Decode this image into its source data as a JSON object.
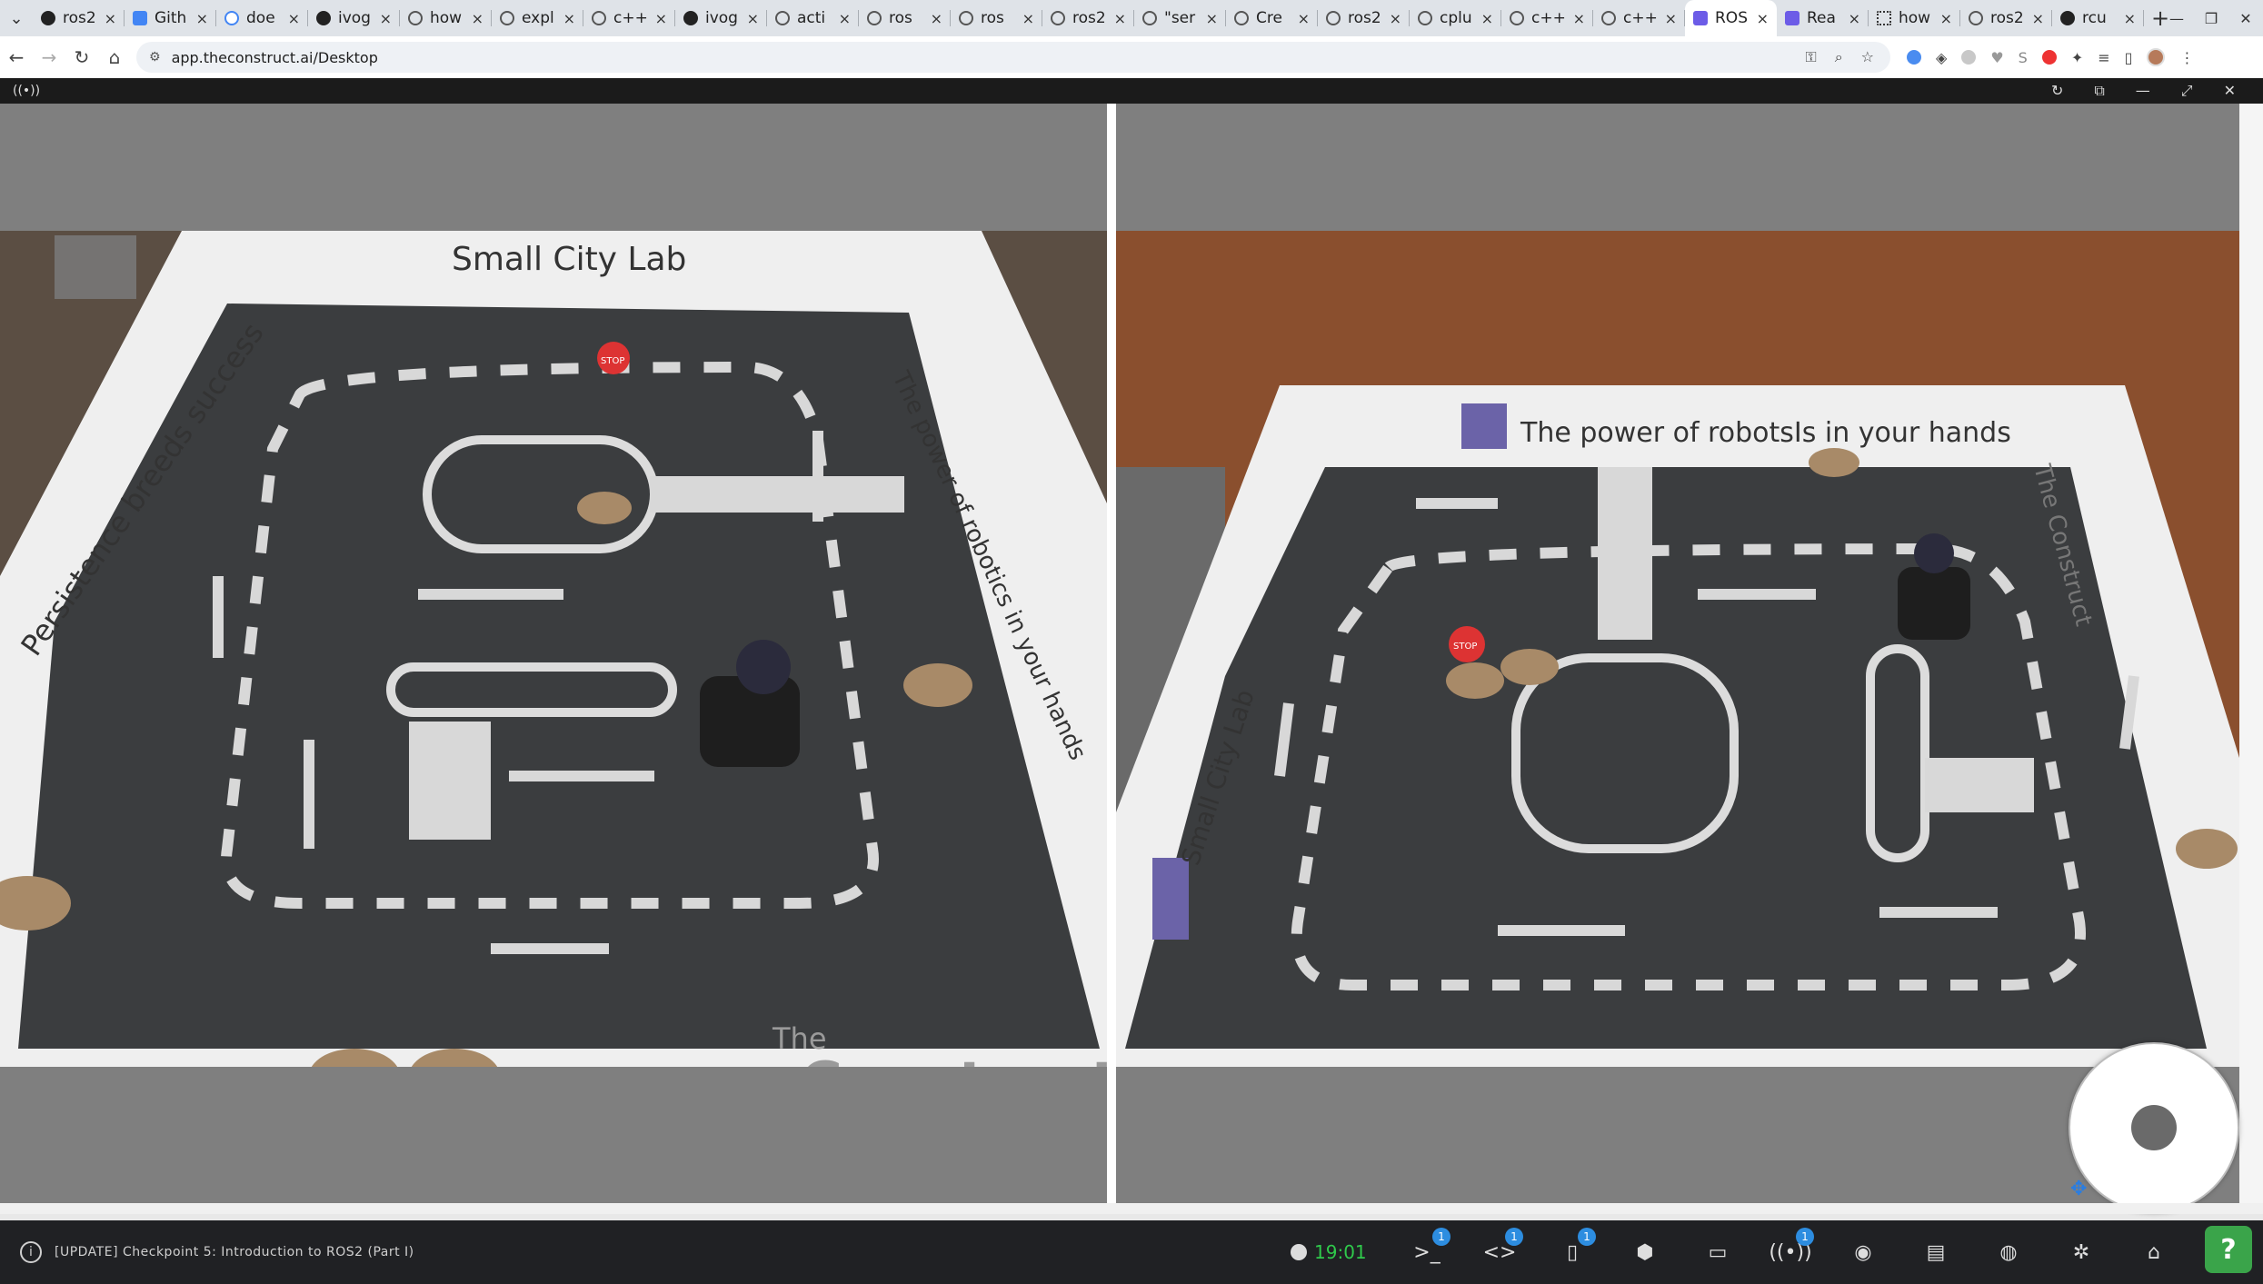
{
  "browser": {
    "tabs": [
      {
        "label": "ros2",
        "icon": "github-icon"
      },
      {
        "label": "Gith",
        "icon": "docs-icon"
      },
      {
        "label": "doe",
        "icon": "google-icon"
      },
      {
        "label": "ivog",
        "icon": "github-icon"
      },
      {
        "label": "how",
        "icon": "page-icon"
      },
      {
        "label": "expl",
        "icon": "chatgpt-icon"
      },
      {
        "label": "c++",
        "icon": "page-icon"
      },
      {
        "label": "ivog",
        "icon": "github-icon"
      },
      {
        "label": "acti",
        "icon": "page-icon"
      },
      {
        "label": "ros",
        "icon": "page-icon"
      },
      {
        "label": "ros",
        "icon": "page-icon"
      },
      {
        "label": "ros2",
        "icon": "page-icon"
      },
      {
        "label": "\"ser",
        "icon": "page-icon"
      },
      {
        "label": "Cre",
        "icon": "page-icon"
      },
      {
        "label": "ros2",
        "icon": "page-icon"
      },
      {
        "label": "cplu",
        "icon": "chatgpt-icon"
      },
      {
        "label": "c++",
        "icon": "page-icon"
      },
      {
        "label": "c++",
        "icon": "page-icon"
      },
      {
        "label": "ROS",
        "icon": "construct-icon",
        "active": true
      },
      {
        "label": "Rea",
        "icon": "construct-icon"
      },
      {
        "label": "how",
        "icon": "grid-icon"
      },
      {
        "label": "ros2",
        "icon": "page-icon"
      },
      {
        "label": "rcu",
        "icon": "github-icon"
      }
    ],
    "url": "app.theconstruct.ai/Desktop",
    "new_tab_symbol": "+",
    "close_symbol": "×"
  },
  "cameras": {
    "left": {
      "sign_top": "Small City Lab",
      "sign_left": "Persistence breeds success",
      "sign_right": "The power of robotics in your hands",
      "floor_logo_small": "The",
      "floor_logo_big": "Construct",
      "stop_text": "STOP"
    },
    "right": {
      "sign_top": "The power of robotsIs in your hands",
      "sign_left": "Small City Lab",
      "sign_right": "The Construct",
      "stop_text": "STOP"
    }
  },
  "status": {
    "update_text": "[UPDATE] Checkpoint 5: Introduction to ROS2 (Part I)",
    "timer": "19:01",
    "info_symbol": "i",
    "help_symbol": "?"
  },
  "dock": [
    {
      "name": "terminal-icon",
      "glyph": ">_",
      "badge": "1"
    },
    {
      "name": "code-editor-icon",
      "glyph": "<>",
      "badge": "1"
    },
    {
      "name": "notebook-icon",
      "glyph": "▯",
      "badge": "1"
    },
    {
      "name": "gazebo-icon",
      "glyph": "⬢",
      "badge": ""
    },
    {
      "name": "desktop-icon",
      "glyph": "▭",
      "badge": ""
    },
    {
      "name": "real-robot-icon",
      "glyph": "((•))",
      "badge": "1"
    },
    {
      "name": "robot-icon",
      "glyph": "◉",
      "badge": ""
    },
    {
      "name": "book-icon",
      "glyph": "▤",
      "badge": ""
    },
    {
      "name": "ai-robot-icon",
      "glyph": "◍",
      "badge": ""
    },
    {
      "name": "chatgpt-icon",
      "glyph": "✲",
      "badge": ""
    },
    {
      "name": "home-icon",
      "glyph": "⌂",
      "badge": ""
    }
  ]
}
